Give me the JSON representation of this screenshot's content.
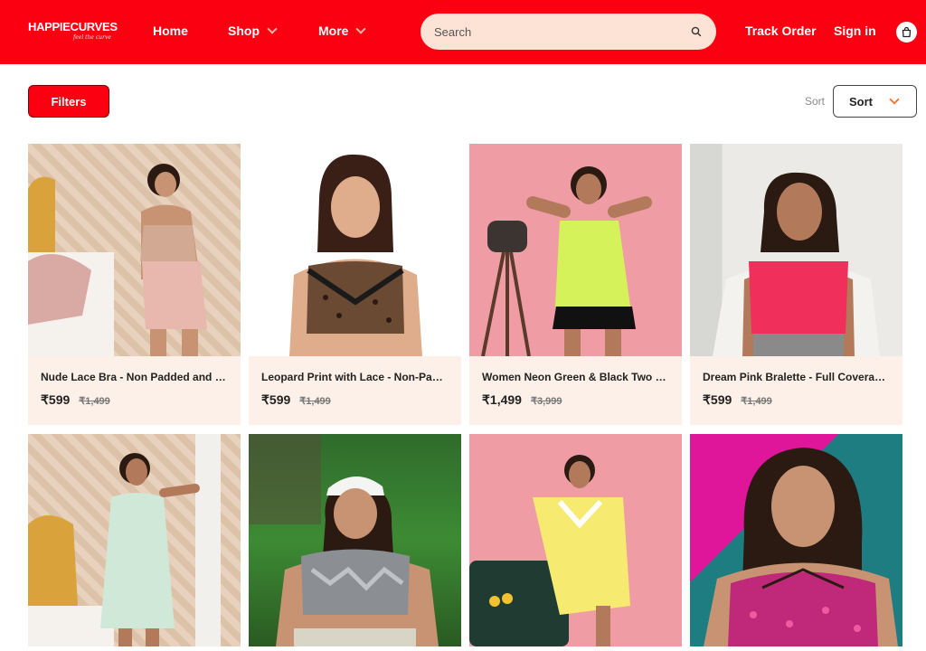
{
  "header": {
    "brand": "HAPPIECURVES",
    "nav": {
      "home": "Home",
      "shop": "Shop",
      "more": "More"
    },
    "search_placeholder": "Search",
    "track_order": "Track Order",
    "sign_in": "Sign in"
  },
  "toolbar": {
    "filters_label": "Filters",
    "sort_label": "Sort",
    "sort_value": "Sort"
  },
  "products": [
    {
      "title": "Nude Lace Bra - Non Padded and Wi...",
      "price": "₹599",
      "mrp": "₹1,499"
    },
    {
      "title": "Leopard Print with Lace - Non-Padd...",
      "price": "₹599",
      "mrp": "₹1,499"
    },
    {
      "title": "Women Neon Green & Black Two Pie...",
      "price": "₹1,499",
      "mrp": "₹3,999"
    },
    {
      "title": "Dream Pink Bralette - Full Coverage...",
      "price": "₹599",
      "mrp": "₹1,499"
    }
  ],
  "colors": {
    "brand_red": "#fb0010",
    "search_bg": "#fde2d6",
    "card_info_bg": "#fdf0e8",
    "sort_accent": "#ef7a3a"
  }
}
